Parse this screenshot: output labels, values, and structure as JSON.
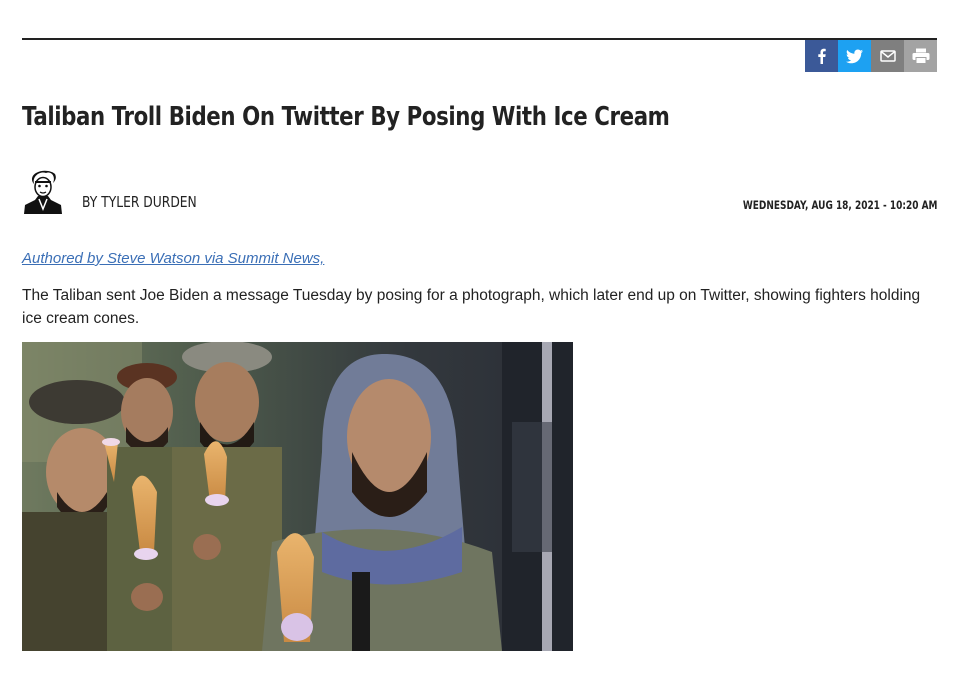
{
  "share": {
    "icons": [
      "facebook-icon",
      "twitter-icon",
      "email-icon",
      "print-icon"
    ],
    "colors": {
      "facebook": "#3b5998",
      "twitter": "#1da1f2",
      "email": "#7f7f7f",
      "print": "#a3a3a3"
    }
  },
  "article": {
    "title": "Taliban Troll Biden On Twitter By Posing With Ice Cream",
    "author": "BY TYLER DURDEN",
    "date": "WEDNESDAY, AUG 18, 2021 - 10:20 AM",
    "authored_by": "Authored by Steve Watson via Summit News,",
    "lede": "The Taliban sent Joe Biden a message Tuesday by posing for a photograph, which later end up on Twitter, showing fighters holding ice cream cones.",
    "link_color": "#3b6fb6"
  }
}
